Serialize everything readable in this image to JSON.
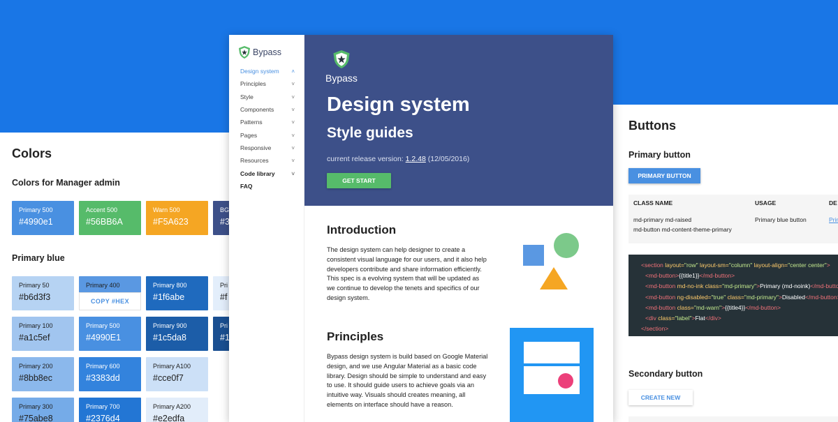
{
  "colors_panel": {
    "title": "Colors",
    "manager_heading": "Colors for Manager admin",
    "manager_swatches": [
      {
        "name": "Primary 500",
        "hex": "#4990e1",
        "color": "#4990e1"
      },
      {
        "name": "Accent 500",
        "hex": "#56BB6A",
        "color": "#56bb6a"
      },
      {
        "name": "Warn 500",
        "hex": "#F5A623",
        "color": "#f5a623"
      },
      {
        "name": "BG",
        "hex": "#3",
        "color": "#3d5089"
      }
    ],
    "blue_heading": "Primary blue",
    "blue_swatches": [
      {
        "name": "Primary 50",
        "hex": "#b6d3f3",
        "color": "#b6d3f3"
      },
      {
        "name": "Primary 400",
        "hex": "",
        "color": "#5a98e2"
      },
      {
        "name": "Primary 800",
        "hex": "#1f6abe",
        "color": "#1f6abe"
      },
      {
        "name": "Pri",
        "hex": "#f",
        "color": "#e3eefb"
      },
      {
        "name": "Primary 100",
        "hex": "#a1c5ef",
        "color": "#a1c5ef"
      },
      {
        "name": "Primary 500",
        "hex": "#4990E1",
        "color": "#4990e1"
      },
      {
        "name": "Primary 900",
        "hex": "#1c5da8",
        "color": "#1c5da8"
      },
      {
        "name": "Pri",
        "hex": "#1",
        "color": "#1a4f91"
      },
      {
        "name": "Primary 200",
        "hex": "#8bb8ec",
        "color": "#8bb8ec"
      },
      {
        "name": "Primary 600",
        "hex": "#3383dd",
        "color": "#3383dd"
      },
      {
        "name": "Primary A100",
        "hex": "#cce0f7",
        "color": "#cce0f7"
      },
      {
        "name": "Primary 300",
        "hex": "#75abe8",
        "color": "#75abe8"
      },
      {
        "name": "Primary 700",
        "hex": "#2376d4",
        "color": "#2376d4"
      },
      {
        "name": "Primary A200",
        "hex": "#e2edfa",
        "color": "#e2edfa"
      }
    ],
    "copy_label": "COPY #HEX"
  },
  "center": {
    "logo_text": "Bypass",
    "nav": [
      {
        "label": "Design system",
        "chevron": "˄"
      },
      {
        "label": "Principles",
        "chevron": "˅"
      },
      {
        "label": "Style",
        "chevron": "˅"
      },
      {
        "label": "Components",
        "chevron": "˅"
      },
      {
        "label": "Patterns",
        "chevron": "˅"
      },
      {
        "label": "Pages",
        "chevron": "˅"
      },
      {
        "label": "Responsive",
        "chevron": "˅"
      },
      {
        "label": "Resources",
        "chevron": "˅"
      },
      {
        "label": "Code library",
        "chevron": "˅"
      },
      {
        "label": "FAQ",
        "chevron": ""
      }
    ],
    "hero": {
      "logo_text": "Bypass",
      "title": "Design system",
      "subtitle": "Style guides",
      "release_prefix": "current release version: ",
      "release_version": "1.2.48",
      "release_date": " (12/05/2016)",
      "cta": "GET START"
    },
    "intro": {
      "title": "Introduction",
      "text": "The design system can help designer to create a consistent visual language for our users, and it also help developers contribute and share information efficiently. This spec is a evolving system that will be updated as we continue to develop the tenets and specifics of our design system."
    },
    "principles": {
      "title": "Principles",
      "text": "Bypass design system is build based on Google Material design, and we use Angular Material as a basic code library. Design should be simple to understand and easy to use. It should guide users to achieve goals via an intuitive way. Visuals should creates meaning, all elements on interface should have a reason."
    }
  },
  "buttons_panel": {
    "title": "Buttons",
    "primary_heading": "Primary button",
    "primary_btn": "PRIMARY BUTTON",
    "table": {
      "headers": [
        "CLASS NAME",
        "USAGE",
        "DE"
      ],
      "class_line1": "md-primary md-raised",
      "class_line2": "md-button md-content-theme-primary",
      "usage": "Primary blue button",
      "link": "Prim"
    },
    "code": {
      "l1_open": "<section",
      "l1_a1": " layout=",
      "l1_v1": "\"row\"",
      "l1_a2": " layout-sm=",
      "l1_v2": "\"column\"",
      "l1_a3": " layout-align=",
      "l1_v3": "\"center center\"",
      "l1_close": ">",
      "l2_open": "<md-button>",
      "l2_text": "{{title1}}",
      "l2_close": "</md-button>",
      "l3_open": "<md-button",
      "l3_a1": " md-no-ink",
      "l3_a2": " class=",
      "l3_v2": "\"md-primary\"",
      "l3_gt": ">",
      "l3_text": "Primary (md-noink)",
      "l3_close": "</md-button>",
      "l4_open": "<md-button",
      "l4_a1": " ng-disabled=",
      "l4_v1": "\"true\"",
      "l4_a2": " class=",
      "l4_v2": "\"md-primary\"",
      "l4_gt": ">",
      "l4_text": "Disabled",
      "l4_close": "</md-button>",
      "l5_open": "<md-button",
      "l5_a1": " class=",
      "l5_v1": "\"md-warn\"",
      "l5_gt": ">",
      "l5_text": "{{title4}}",
      "l5_close": "</md-button>",
      "l6_open": "<div",
      "l6_a1": " class=",
      "l6_v1": "\"label\"",
      "l6_gt": ">",
      "l6_text": "Flat",
      "l6_close": "</div>",
      "l7_close": "</section>"
    },
    "secondary_heading": "Secondary button",
    "create_btn": "CREATE NEW"
  }
}
